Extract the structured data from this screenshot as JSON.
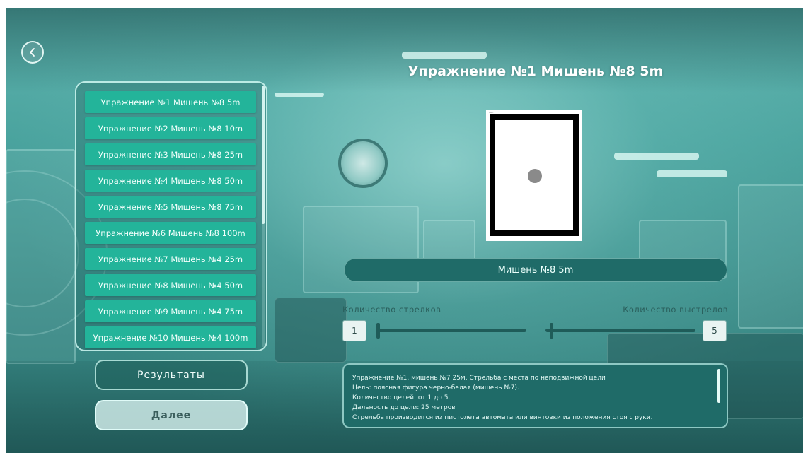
{
  "title": "Упражнение №1 Мишень №8 5m",
  "exercises": [
    "Упражнение №1 Мишень №8 5m",
    "Упражнение №2 Мишень №8 10m",
    "Упражнение №3 Мишень №8 25m",
    "Упражнение №4 Мишень №8 50m",
    "Упражнение №5 Мишень №8 75m",
    "Упражнение №6 Мишень №8 100m",
    "Упражнение №7 Мишень №4 25m",
    "Упражнение №8 Мишень №4 50m",
    "Упражнение №9 Мишень №4 75m",
    "Упражнение №10 Мишень №4 100m"
  ],
  "buttons": {
    "results": "Результаты",
    "next": "Далее"
  },
  "target": {
    "name": "Мишень №8 5m"
  },
  "settings": {
    "shooters_label": "Количество стрелков",
    "shooters_value": "1",
    "shots_label": "Количество выстрелов",
    "shots_value": "5"
  },
  "description": [
    "Упражнение №1. мишень №7 25м. Стрельба с места по неподвижной цели",
    "Цель: поясная фигура черно-белая (мишень №7).",
    "Количество целей: от 1 до 5.",
    "Дальность до цели: 25 метров",
    "Стрельба производится из пистолета автомата или винтовки из положения стоя с руки."
  ],
  "icons": {
    "back": "chevron-left-icon"
  },
  "colors": {
    "list_item": "#23b49a",
    "panel_dark": "#1f6b68",
    "slider": "#1f5c59"
  }
}
